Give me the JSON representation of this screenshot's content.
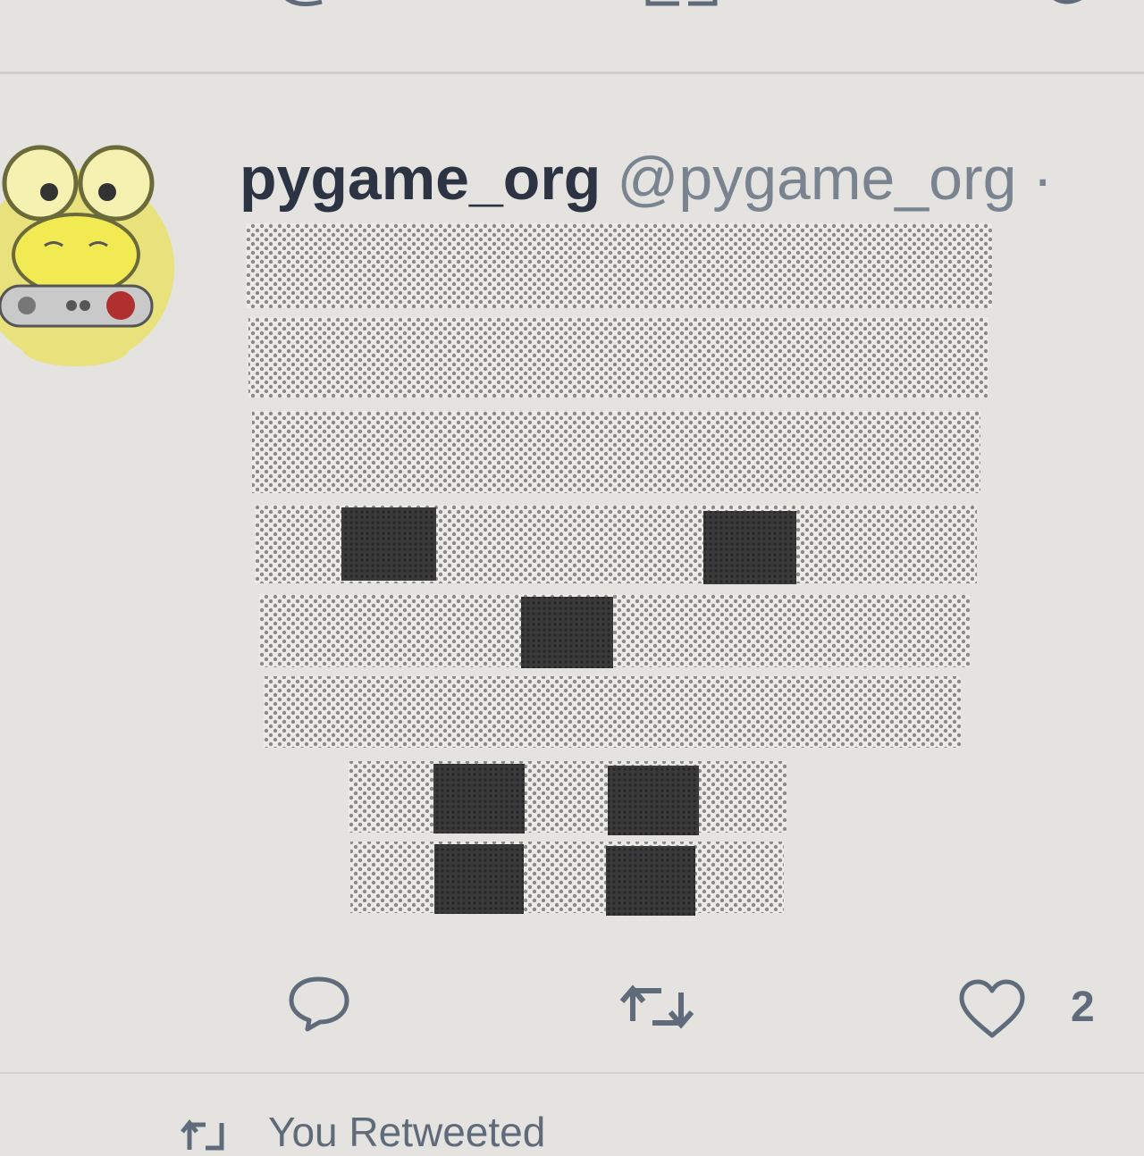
{
  "tweet": {
    "display_name": "pygame_org",
    "handle": "@pygame_org",
    "separator": "·",
    "actions": {
      "reply_icon": "reply-icon",
      "retweet_icon": "retweet-icon",
      "like_icon": "heart-icon",
      "like_count": "2"
    }
  },
  "retweet_notice": {
    "icon": "retweet-icon",
    "text": "You Retweeted"
  },
  "colors": {
    "text_dark": "#2c3443",
    "text_muted": "#7a8390",
    "pattern_light": "#8a8a88",
    "pattern_dark": "#2e2e2e"
  }
}
